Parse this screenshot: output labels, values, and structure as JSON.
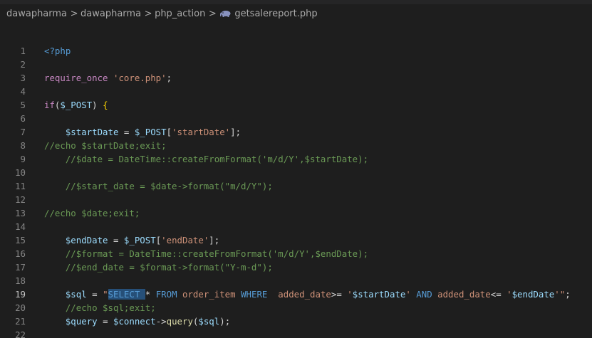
{
  "breadcrumb": {
    "items": [
      "dawapharma",
      "dawapharma",
      "php_action"
    ],
    "file": "getsalereport.php",
    "separator": ">",
    "file_icon": "php-elephant-icon"
  },
  "editor": {
    "active_line": 19,
    "lines": [
      {
        "n": "1",
        "segs": [
          {
            "t": "<?php",
            "c": "kw"
          }
        ]
      },
      {
        "n": "2",
        "segs": []
      },
      {
        "n": "3",
        "segs": [
          {
            "t": "require_once",
            "c": "ctl"
          },
          {
            "t": " ",
            "c": "op"
          },
          {
            "t": "'core.php'",
            "c": "str"
          },
          {
            "t": ";",
            "c": "op"
          }
        ]
      },
      {
        "n": "4",
        "segs": []
      },
      {
        "n": "5",
        "segs": [
          {
            "t": "if",
            "c": "ctl"
          },
          {
            "t": "(",
            "c": "op"
          },
          {
            "t": "$_POST",
            "c": "var"
          },
          {
            "t": ") ",
            "c": "op"
          },
          {
            "t": "{",
            "c": "br"
          }
        ]
      },
      {
        "n": "6",
        "segs": []
      },
      {
        "n": "7",
        "segs": [
          {
            "t": "    ",
            "c": "op"
          },
          {
            "t": "$startDate",
            "c": "var"
          },
          {
            "t": " = ",
            "c": "op"
          },
          {
            "t": "$_POST",
            "c": "var"
          },
          {
            "t": "[",
            "c": "op"
          },
          {
            "t": "'startDate'",
            "c": "str"
          },
          {
            "t": "];",
            "c": "op"
          }
        ]
      },
      {
        "n": "8",
        "segs": [
          {
            "t": "//echo $startDate;exit;",
            "c": "cmt"
          }
        ]
      },
      {
        "n": "9",
        "segs": [
          {
            "t": "    ",
            "c": "op"
          },
          {
            "t": "//$date = DateTime::createFromFormat('m/d/Y',$startDate);",
            "c": "cmt"
          }
        ]
      },
      {
        "n": "10",
        "segs": []
      },
      {
        "n": "11",
        "segs": [
          {
            "t": "    ",
            "c": "op"
          },
          {
            "t": "//$start_date = $date->format(\"m/d/Y\");",
            "c": "cmt"
          }
        ]
      },
      {
        "n": "12",
        "segs": []
      },
      {
        "n": "13",
        "segs": [
          {
            "t": "//echo $date;exit;",
            "c": "cmt"
          }
        ]
      },
      {
        "n": "14",
        "segs": []
      },
      {
        "n": "15",
        "segs": [
          {
            "t": "    ",
            "c": "op"
          },
          {
            "t": "$endDate",
            "c": "var"
          },
          {
            "t": " = ",
            "c": "op"
          },
          {
            "t": "$_POST",
            "c": "var"
          },
          {
            "t": "[",
            "c": "op"
          },
          {
            "t": "'endDate'",
            "c": "str"
          },
          {
            "t": "];",
            "c": "op"
          }
        ]
      },
      {
        "n": "16",
        "segs": [
          {
            "t": "    ",
            "c": "op"
          },
          {
            "t": "//$format = DateTime::createFromFormat('m/d/Y',$endDate);",
            "c": "cmt"
          }
        ]
      },
      {
        "n": "17",
        "segs": [
          {
            "t": "    ",
            "c": "op"
          },
          {
            "t": "//$end_date = $format->format(\"Y-m-d\");",
            "c": "cmt"
          }
        ]
      },
      {
        "n": "18",
        "segs": []
      },
      {
        "n": "19",
        "segs": [
          {
            "t": "    ",
            "c": "op"
          },
          {
            "t": "$sql",
            "c": "var"
          },
          {
            "t": " = ",
            "c": "op"
          },
          {
            "t": "\"",
            "c": "str"
          },
          {
            "t": "SELECT ",
            "c": "kw hl"
          },
          {
            "t": "* ",
            "c": "op"
          },
          {
            "t": "FROM ",
            "c": "kw"
          },
          {
            "t": "order_item ",
            "c": "str"
          },
          {
            "t": "WHERE  ",
            "c": "kw"
          },
          {
            "t": "added_date",
            "c": "str"
          },
          {
            "t": ">= ",
            "c": "op"
          },
          {
            "t": "'",
            "c": "str"
          },
          {
            "t": "$startDate",
            "c": "var"
          },
          {
            "t": "' ",
            "c": "str"
          },
          {
            "t": "AND ",
            "c": "kw"
          },
          {
            "t": "added_date",
            "c": "str"
          },
          {
            "t": "<= ",
            "c": "op"
          },
          {
            "t": "'",
            "c": "str"
          },
          {
            "t": "$endDate",
            "c": "var"
          },
          {
            "t": "'\"",
            "c": "str"
          },
          {
            "t": ";",
            "c": "op"
          }
        ]
      },
      {
        "n": "20",
        "segs": [
          {
            "t": "    ",
            "c": "op"
          },
          {
            "t": "//echo $sql;exit;",
            "c": "cmt"
          }
        ]
      },
      {
        "n": "21",
        "segs": [
          {
            "t": "    ",
            "c": "op"
          },
          {
            "t": "$query",
            "c": "var"
          },
          {
            "t": " = ",
            "c": "op"
          },
          {
            "t": "$connect",
            "c": "var"
          },
          {
            "t": "->",
            "c": "op"
          },
          {
            "t": "query",
            "c": "fn"
          },
          {
            "t": "(",
            "c": "op"
          },
          {
            "t": "$sql",
            "c": "var"
          },
          {
            "t": ");",
            "c": "op"
          }
        ]
      },
      {
        "n": "22",
        "segs": []
      }
    ]
  }
}
